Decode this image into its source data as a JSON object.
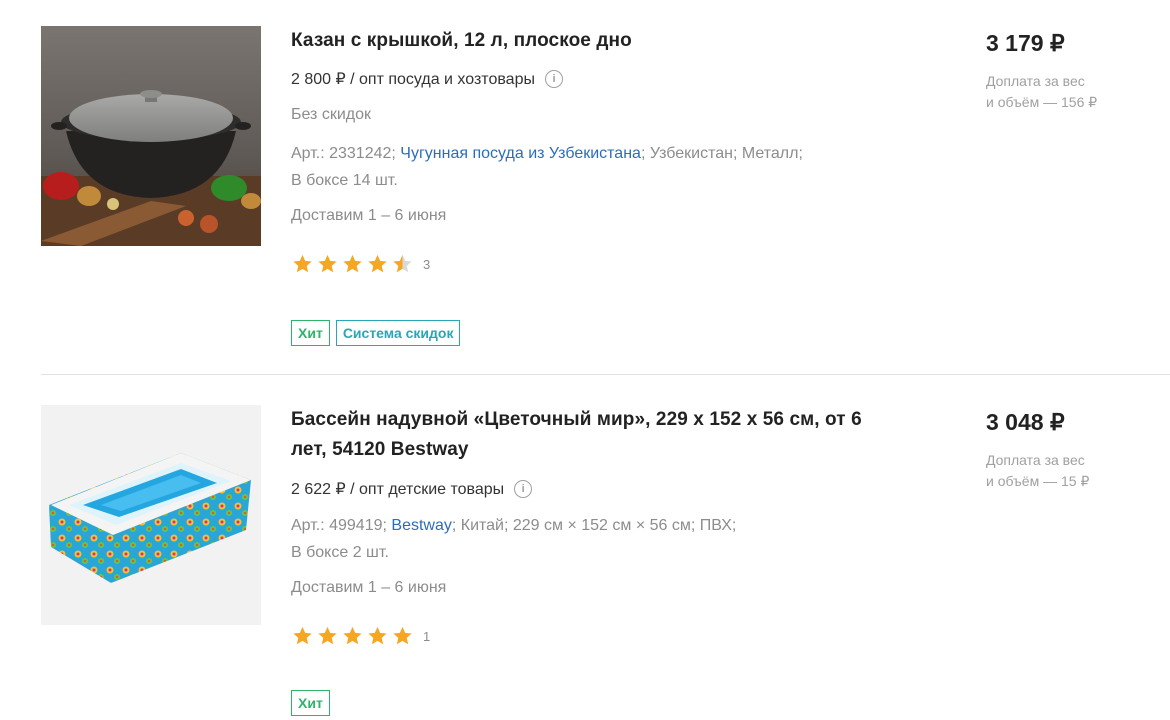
{
  "products": [
    {
      "title": "Казан с крышкой, 12 л, плоское дно",
      "opt_price": "2 800 ₽ / опт посуда и хозтовары",
      "discount_note": "Без скидок",
      "meta_prefix": "Арт.: 2331242; ",
      "meta_link": "Чугунная посуда из Узбекистана",
      "meta_suffix": "; Узбекистан; Металл;",
      "box": "В боксе 14 шт.",
      "delivery": "Доставим 1 – 6 июня",
      "rating": 4.5,
      "rating_count": "3",
      "badges": [
        "Хит",
        "Система скидок"
      ],
      "price": "3 179 ₽",
      "surcharge_line1": "Доплата за вес",
      "surcharge_line2": "и объём — 156 ₽",
      "image_icon": "cauldron-image"
    },
    {
      "title": "Бассейн надувной «Цветочный мир», 229 х 152 х 56 см, от 6 лет, 54120 Bestway",
      "opt_price": "2 622 ₽ / опт детские товары",
      "meta_prefix": "Арт.: 499419; ",
      "meta_link": "Bestway",
      "meta_suffix": "; Китай; 229 см × 152 см × 56 см; ПВХ;",
      "box": "В боксе 2 шт.",
      "delivery": "Доставим 1 – 6 июня",
      "rating": 5,
      "rating_count": "1",
      "badges": [
        "Хит"
      ],
      "price": "3 048 ₽",
      "surcharge_line1": "Доплата за вес",
      "surcharge_line2": "и объём — 15 ₽",
      "image_icon": "inflatable-pool-image"
    }
  ],
  "info_icon_glyph": "i",
  "colors": {
    "link": "#2c6db8",
    "muted": "#8c8c8c",
    "star": "#f5a623",
    "hit_badge": "#2eb36b",
    "discount_badge": "#2aa7b5"
  }
}
